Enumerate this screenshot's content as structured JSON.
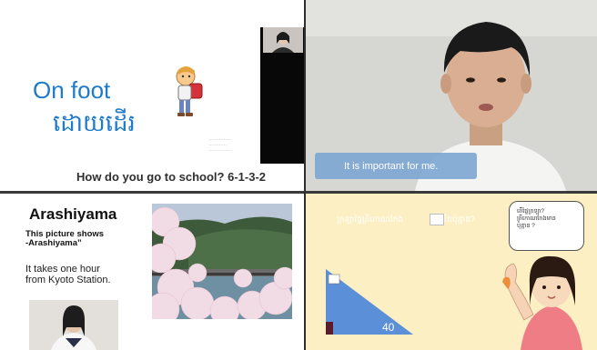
{
  "top_left": {
    "heading": "On foot",
    "khmer_text": "ដោយដើរ",
    "caption": "How do you go to school? 6-1-3-2",
    "credit_lines": [
      "……………",
      "…………",
      "……………"
    ]
  },
  "top_right": {
    "subtitle": "It is important for me."
  },
  "bottom_left": {
    "title": "Arashiyama",
    "picture_line1": "This picture shows",
    "picture_line2": "-Arashiyama”",
    "time_line1": "It takes one hour",
    "time_line2": "from Kyoto Station."
  },
  "bottom_right": {
    "question_text": "ក្រឡាផ្ទៃត្រីកោណកែង",
    "question_text2": "ស្មើនឹងប៉ុន្មាន?",
    "bubble_text": "តើផ្ទៃក្រឡា?\nត្រីកោណកែងមាន\nប៉ុន្មាន ?",
    "angle_label": "40"
  },
  "colors": {
    "accent_blue": "#1f7ac9",
    "subtitle_bg": "#7ea7d2",
    "slide_yellow": "#fcefc3",
    "triangle_blue": "#5b8fd8"
  }
}
